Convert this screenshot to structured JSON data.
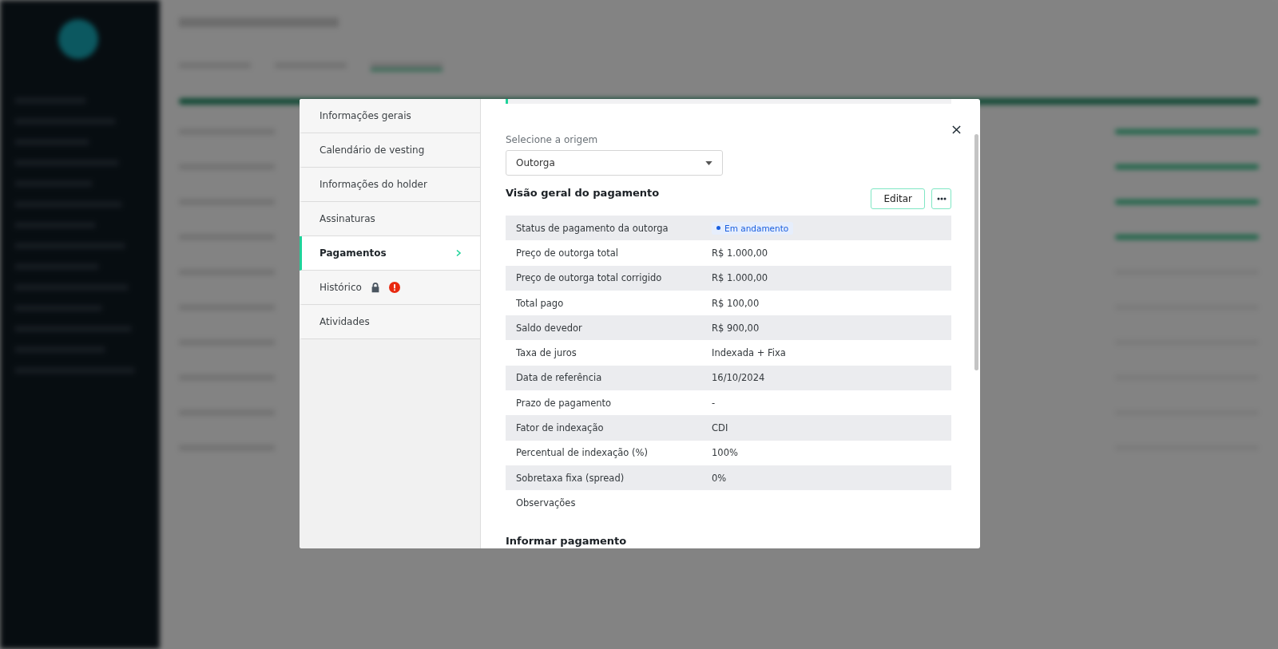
{
  "nav": [
    {
      "label": "Informações gerais",
      "selected": false,
      "locked": false,
      "alert": false
    },
    {
      "label": "Calendário de vesting",
      "selected": false,
      "locked": false,
      "alert": false
    },
    {
      "label": "Informações do holder",
      "selected": false,
      "locked": false,
      "alert": false
    },
    {
      "label": "Assinaturas",
      "selected": false,
      "locked": false,
      "alert": false
    },
    {
      "label": "Pagamentos",
      "selected": true,
      "locked": false,
      "alert": false
    },
    {
      "label": "Histórico",
      "selected": false,
      "locked": true,
      "alert": true
    },
    {
      "label": "Atividades",
      "selected": false,
      "locked": false,
      "alert": false
    }
  ],
  "progress": {
    "level": 0.006
  },
  "origin": {
    "label": "Selecione a origem",
    "value": "Outorga"
  },
  "overview": {
    "title": "Visão geral do pagamento",
    "edit_button": "Editar",
    "rows": [
      {
        "label": "Status de pagamento da outorga",
        "value": "Em andamento",
        "kind": "badge",
        "color": "#1a5fe0"
      },
      {
        "label": "Preço de outorga total",
        "value": "R$ 1.000,00",
        "kind": "text"
      },
      {
        "label": "Preço de outorga total corrigido",
        "value": "R$ 1.000,00",
        "kind": "text"
      },
      {
        "label": "Total pago",
        "value": "R$ 100,00",
        "kind": "text"
      },
      {
        "label": "Saldo devedor",
        "value": "R$ 900,00",
        "kind": "text"
      },
      {
        "label": "Taxa de juros",
        "value": "Indexada + Fixa",
        "kind": "text"
      },
      {
        "label": "Data de referência",
        "value": "16/10/2024",
        "kind": "text"
      },
      {
        "label": "Prazo de pagamento",
        "value": "-",
        "kind": "text"
      },
      {
        "label": "Fator de indexação",
        "value": "CDI",
        "kind": "text"
      },
      {
        "label": "Percentual de indexação (%)",
        "value": "100%",
        "kind": "text"
      },
      {
        "label": "Sobretaxa fixa (spread)",
        "value": "0%",
        "kind": "text"
      },
      {
        "label": "Observações",
        "kind": "text"
      }
    ]
  },
  "next_section": {
    "title": "Informar pagamento"
  }
}
